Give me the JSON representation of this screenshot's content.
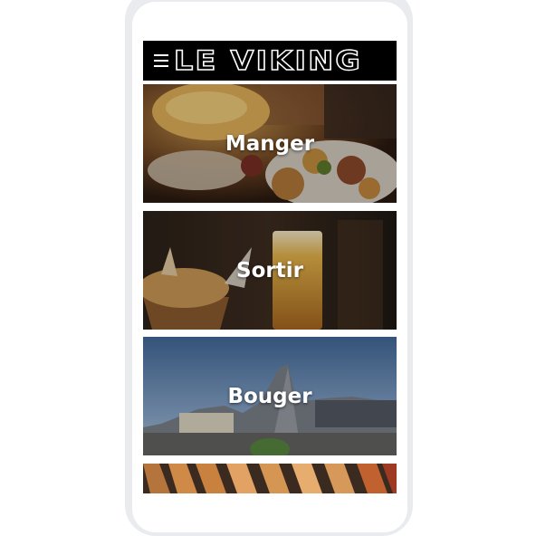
{
  "app": {
    "logo_text": "LE VIKING"
  },
  "menu": {
    "icon": "hamburger-menu-icon"
  },
  "cards": [
    {
      "label": "Manger",
      "image": "food-plate-photo"
    },
    {
      "label": "Sortir",
      "image": "beer-and-fries-photo"
    },
    {
      "label": "Bouger",
      "image": "city-architecture-photo"
    },
    {
      "label": "",
      "image": "wooden-hangers-photo"
    }
  ]
}
